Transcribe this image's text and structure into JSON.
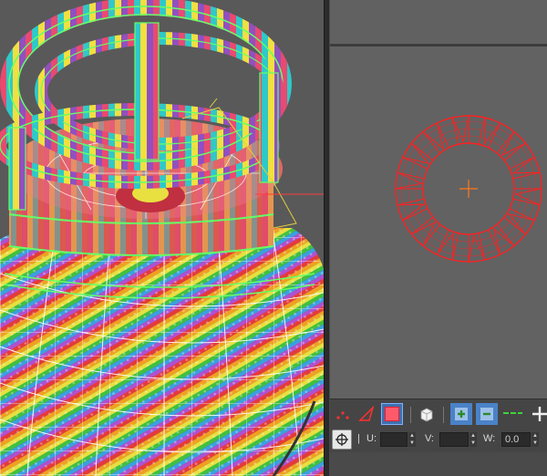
{
  "viewport": {
    "model": "gas-cylinder-checker-uv",
    "colors": {
      "background": "#595959",
      "wire": "#ffffff",
      "selection_wire": "#66ff66",
      "gizmo": "#e0d040",
      "axis": "#ff3a3a"
    }
  },
  "uv_editor": {
    "colors": {
      "uv_wire": "#ff2020",
      "pivot": "#ff7a1a",
      "background": "#626262"
    }
  },
  "toolbar_1": {
    "icons": [
      "vertex-mode-icon",
      "edge-mode-icon",
      "polygon-mode-icon",
      "element-mode-icon",
      "grow-selection-icon",
      "shrink-selection-icon",
      "ring-icon",
      "move-cross-icon"
    ]
  },
  "toolbar_2": {
    "u_label": "U:",
    "v_label": "V:",
    "w_label": "W:",
    "u_value": "",
    "v_value": "",
    "w_value": "0.0",
    "separator": "|"
  }
}
